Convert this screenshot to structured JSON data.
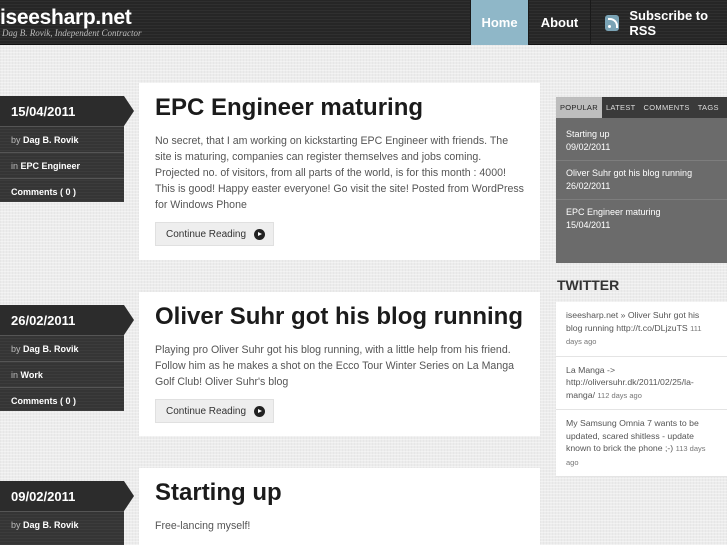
{
  "header": {
    "site_title": "iseesharp.net",
    "tagline": "Dag B. Rovik, Independent Contractor",
    "nav": {
      "home": "Home",
      "about": "About",
      "rss": "Subscribe to RSS"
    }
  },
  "posts": [
    {
      "date": "15/04/2011",
      "by_label": "by",
      "author": "Dag B. Rovik",
      "in_label": "in",
      "category": "EPC Engineer",
      "comments": "Comments ( 0 )",
      "title": "EPC Engineer maturing",
      "body": "No secret, that I am working on kickstarting EPC Engineer with friends. The site is maturing, companies can register themselves and jobs coming. Projected no. of visitors, from all parts of the world, is for this month : 4000! This is good! Happy easter everyone! Go visit the site! Posted from WordPress for Windows Phone",
      "continue": "Continue Reading"
    },
    {
      "date": "26/02/2011",
      "by_label": "by",
      "author": "Dag B. Rovik",
      "in_label": "in",
      "category": "Work",
      "comments": "Comments ( 0 )",
      "title": "Oliver Suhr got his blog running",
      "body": "Playing pro Oliver Suhr got his blog running, with a little help from his friend. Follow him as he makes a shot on the Ecco Tour Winter Series on La Manga Golf Club! Oliver Suhr's blog",
      "continue": "Continue Reading"
    },
    {
      "date": "09/02/2011",
      "by_label": "by",
      "author": "Dag B. Rovik",
      "title": "Starting up",
      "body": "Free-lancing myself!"
    }
  ],
  "sidebar": {
    "tabs": [
      "POPULAR",
      "LATEST",
      "COMMENTS",
      "TAGS"
    ],
    "popular": [
      {
        "title": "Starting up",
        "date": "09/02/2011"
      },
      {
        "title": "Oliver Suhr got his blog running",
        "date": "26/02/2011"
      },
      {
        "title": "EPC Engineer maturing",
        "date": "15/04/2011"
      }
    ],
    "twitter_title": "TWITTER",
    "tweets": [
      {
        "text": "iseesharp.net » Oliver Suhr got his blog running http://t.co/DLjzuTS",
        "ago": "111 days ago"
      },
      {
        "text": "La Manga -> http://oliversuhr.dk/2011/02/25/la-manga/",
        "ago": "112 days ago"
      },
      {
        "text": "My Samsung Omnia 7 wants to be updated, scared shitless - update known to brick the phone ;-)",
        "ago": "113 days ago"
      }
    ]
  },
  "colors": {
    "header_bg": "#2b2b2b",
    "nav_active": "#8fb7c8",
    "meta_bg": "#3a3a3a",
    "page_bg": "#ececec"
  }
}
